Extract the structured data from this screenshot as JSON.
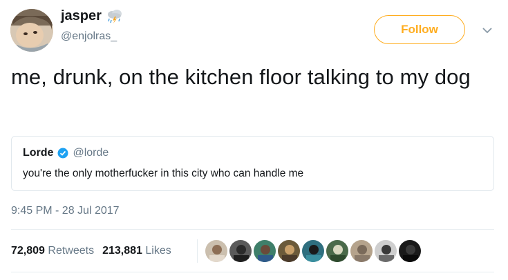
{
  "author": {
    "display_name": "jasper",
    "handle": "@enjolras_",
    "name_emoji": "cloud-with-lightning-and-rain-icon"
  },
  "follow_button": {
    "label": "Follow"
  },
  "tweet": {
    "text": "me, drunk, on the kitchen floor talking to my dog",
    "timestamp": "9:45 PM - 28 Jul 2017"
  },
  "quoted_tweet": {
    "display_name": "Lorde",
    "handle": "@lorde",
    "verified": true,
    "text": "you're the only motherfucker in this city who can handle me"
  },
  "stats": {
    "retweets_count": "72,809",
    "retweets_label": "Retweets",
    "likes_count": "213,881",
    "likes_label": "Likes"
  },
  "liker_avatars": [
    "liker-1",
    "liker-2",
    "liker-3",
    "liker-4",
    "liker-5",
    "liker-6",
    "liker-7",
    "liker-8",
    "liker-9"
  ],
  "colors": {
    "follow_accent": "#ffad1f",
    "secondary_text": "#657786",
    "verified_badge": "#1da1f2",
    "border": "#e1e8ed"
  }
}
